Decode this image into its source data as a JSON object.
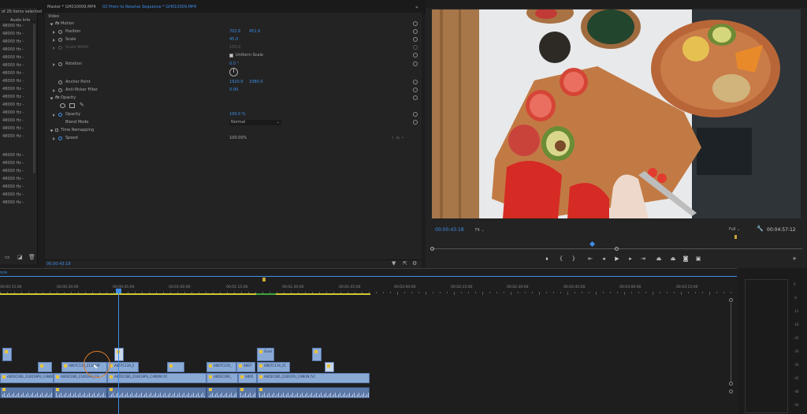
{
  "project": {
    "items_text": "of 26 items selected",
    "audio_info_header": "Audio Info",
    "rows": [
      "48000 Hz -",
      "48000 Hz -",
      "48000 Hz -",
      "48000 Hz -",
      "48000 Hz -",
      "48000 Hz -",
      "48000 Hz -",
      "48000 Hz -",
      "48000 Hz -",
      "48000 Hz -",
      "48000 Hz -",
      "48000 Hz -",
      "48000 Hz -",
      "48000 Hz -",
      "48000 Hz -",
      "48000 Hz -",
      "48000 Hz -",
      "48000 Hz -",
      "48000 Hz -",
      "48000 Hz -",
      "48000 Hz -",
      "48000 Hz -"
    ]
  },
  "tabs": {
    "master": "Master * GH010009.MP4",
    "sequence": "02 Prem to Resolve Sequence * GH010009.MP4"
  },
  "effect_controls": {
    "video_header": "Video",
    "motion": "Motion",
    "position_label": "Position",
    "position_x": "702.6",
    "position_y": "451.6",
    "scale_label": "Scale",
    "scale_value": "45.0",
    "scale_width_label": "Scale Width",
    "scale_width_value": "100.0",
    "uniform_scale": "Uniform Scale",
    "rotation_label": "Rotation",
    "rotation_value": "0.0 °",
    "anchor_label": "Anchor Point",
    "anchor_x": "1920.0",
    "anchor_y": "1080.0",
    "flicker_label": "Anti-flicker Filter",
    "flicker_value": "0.00",
    "opacity_header": "Opacity",
    "opacity_label": "Opacity",
    "opacity_value": "100.0 %",
    "blend_label": "Blend Mode",
    "blend_value": "Normal",
    "time_remap": "Time Remapping",
    "speed_label": "Speed",
    "speed_value": "100.00%",
    "timecode": "00:00:43:18"
  },
  "monitor": {
    "timecode": "00:00:43:18",
    "fit": "Fit",
    "quality": "Full",
    "duration": "00:04:57:12"
  },
  "timeline": {
    "ruler": [
      "00:00:15:00",
      "00:00:30:00",
      "00:00:45:00",
      "00:01:00:00",
      "00:01:15:00",
      "00:01:30:00",
      "00:01:45:00",
      "00:02:00:00",
      "00:02:15:00",
      "00:02:30:00",
      "00:02:45:00",
      "00:03:00:00",
      "00:03:15:00"
    ],
    "clips_v2": [
      "A067C119_2",
      "A067C119_21101PF",
      "A067C119_2",
      "A067C119_",
      "A067",
      "A067C119_21"
    ],
    "clips_v1": [
      "A065C006_210019PU_CANON [V]",
      "A065C006_21001PU_CA",
      "A065C006_210019PU_CANON [V]",
      "A065C006_",
      "A065",
      "A065C006_21001PU_CANON [V]"
    ],
    "grad_label": "Grad"
  },
  "colors": {
    "accent": "#3f8ee8",
    "clip": "#8aaad6",
    "audio": "#5b78a6"
  }
}
